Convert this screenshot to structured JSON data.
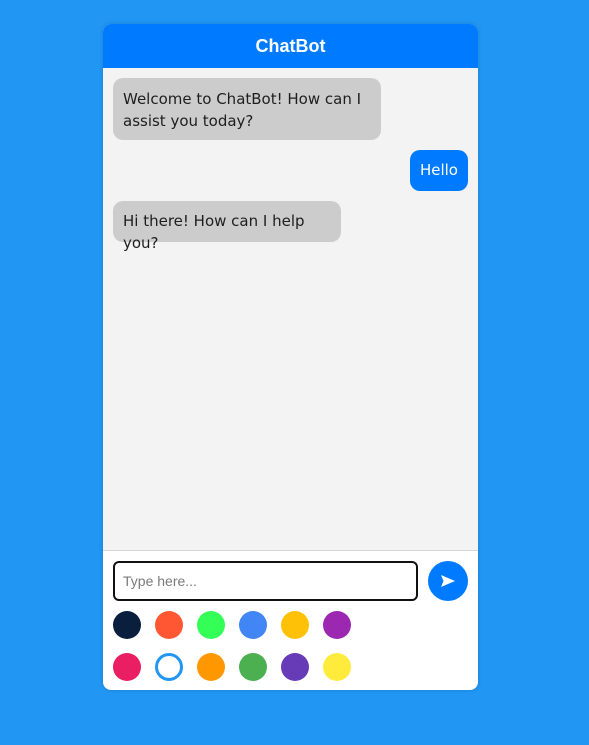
{
  "header": {
    "title": "ChatBot"
  },
  "messages": [
    {
      "sender": "bot",
      "text": "Welcome to ChatBot! How can I assist you today?"
    },
    {
      "sender": "user",
      "text": "Hello"
    },
    {
      "sender": "bot",
      "text": "Hi there! How can I help you?"
    }
  ],
  "input": {
    "placeholder": "Type here...",
    "value": ""
  },
  "send_button": {
    "icon": "send-arrow-icon"
  },
  "colors": {
    "background": "#2196f3",
    "header": "#007bff",
    "bot_bubble": "#cccccc",
    "user_bubble": "#007bff",
    "messages_area": "#f3f3f3"
  },
  "color_palette": {
    "row1": [
      "#0a1f3d",
      "#ff5733",
      "#33ff57",
      "#4285f4",
      "#ffc107",
      "#9c27b0"
    ],
    "row2": [
      "#e91e63",
      "#ffffff",
      "#ff9800",
      "#4caf50",
      "#673ab7",
      "#ffeb3b"
    ],
    "selected": "#ffffff",
    "selected_ring": "#2196f3"
  }
}
